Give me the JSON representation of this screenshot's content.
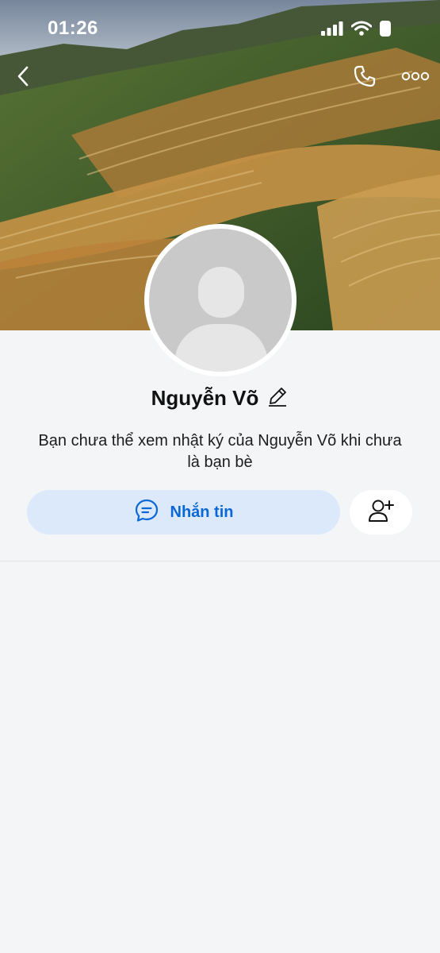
{
  "status_bar": {
    "time": "01:26"
  },
  "header": {
    "back_icon": "chevron-left-icon",
    "call_icon": "phone-icon",
    "more_icon": "more-dots-icon"
  },
  "profile": {
    "name": "Nguyễn Võ",
    "notice": "Bạn chưa thể xem nhật ký của Nguyễn Võ khi chưa là bạn bè",
    "message_button_label": "Nhắn tin"
  },
  "colors": {
    "accent": "#0a68d6",
    "button_bg": "#dce9fb",
    "page_bg": "#f4f5f7"
  }
}
